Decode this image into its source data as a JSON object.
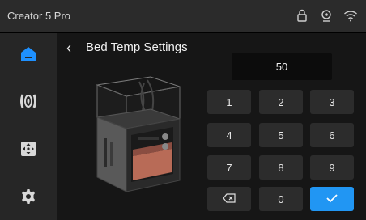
{
  "status_bar": {
    "device_name": "Creator 5 Pro",
    "icons": [
      "lock-icon",
      "camera-icon",
      "wifi-icon"
    ]
  },
  "sidebar": {
    "items": [
      {
        "name": "home",
        "icon": "home-icon",
        "active": true
      },
      {
        "name": "filament",
        "icon": "filament-spool-icon",
        "active": false
      },
      {
        "name": "move",
        "icon": "move-control-icon",
        "active": false
      },
      {
        "name": "settings",
        "icon": "gear-icon",
        "active": false
      }
    ]
  },
  "page": {
    "back_glyph": "‹",
    "title": "Bed Temp Settings"
  },
  "input": {
    "value": "50"
  },
  "keypad": {
    "keys": [
      "1",
      "2",
      "3",
      "4",
      "5",
      "6",
      "7",
      "8",
      "9",
      "⌫",
      "0",
      "✓"
    ]
  },
  "colors": {
    "accent": "#2196f3",
    "active_icon": "#1e90ff",
    "key_bg": "#2c2c2c",
    "panel_bg": "#161616",
    "sidebar_bg": "#262626"
  }
}
